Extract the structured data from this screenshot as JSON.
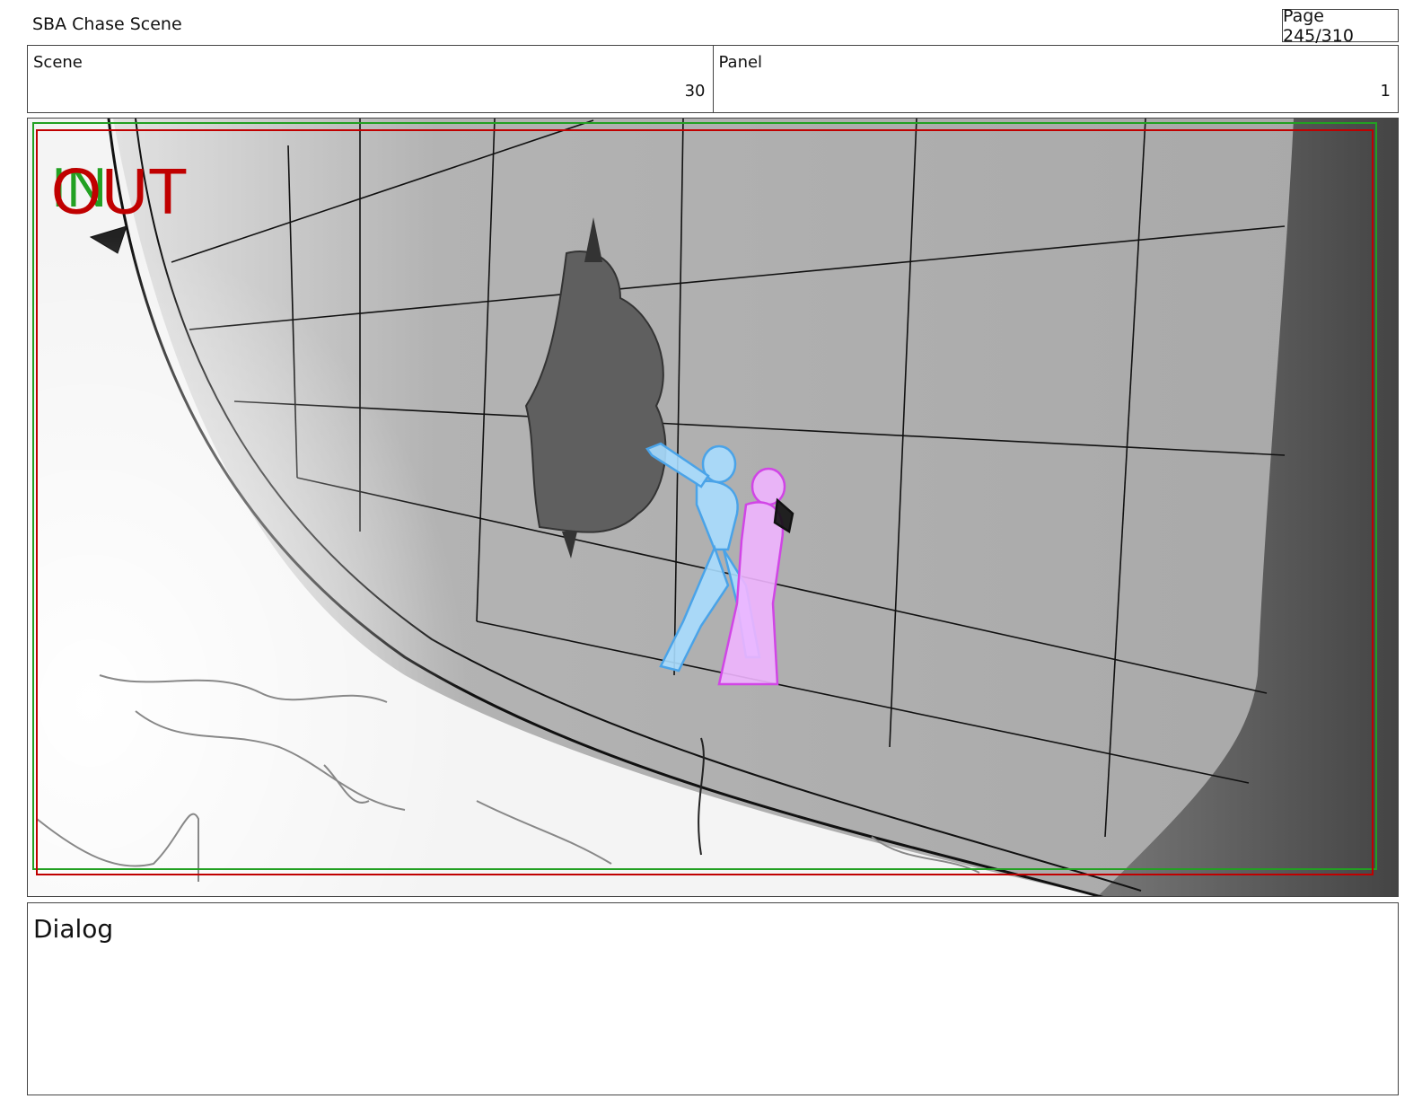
{
  "header": {
    "title": "SBA Chase Scene",
    "page_label": "Page 245/310"
  },
  "info": {
    "scene_label": "Scene",
    "scene_value": "30",
    "panel_label": "Panel",
    "panel_value": "1"
  },
  "frame": {
    "in_marker": "IN",
    "out_marker": "OUT",
    "in_color": "#22a022",
    "out_color": "#c00000"
  },
  "dialog": {
    "label": "Dialog",
    "text": ""
  }
}
